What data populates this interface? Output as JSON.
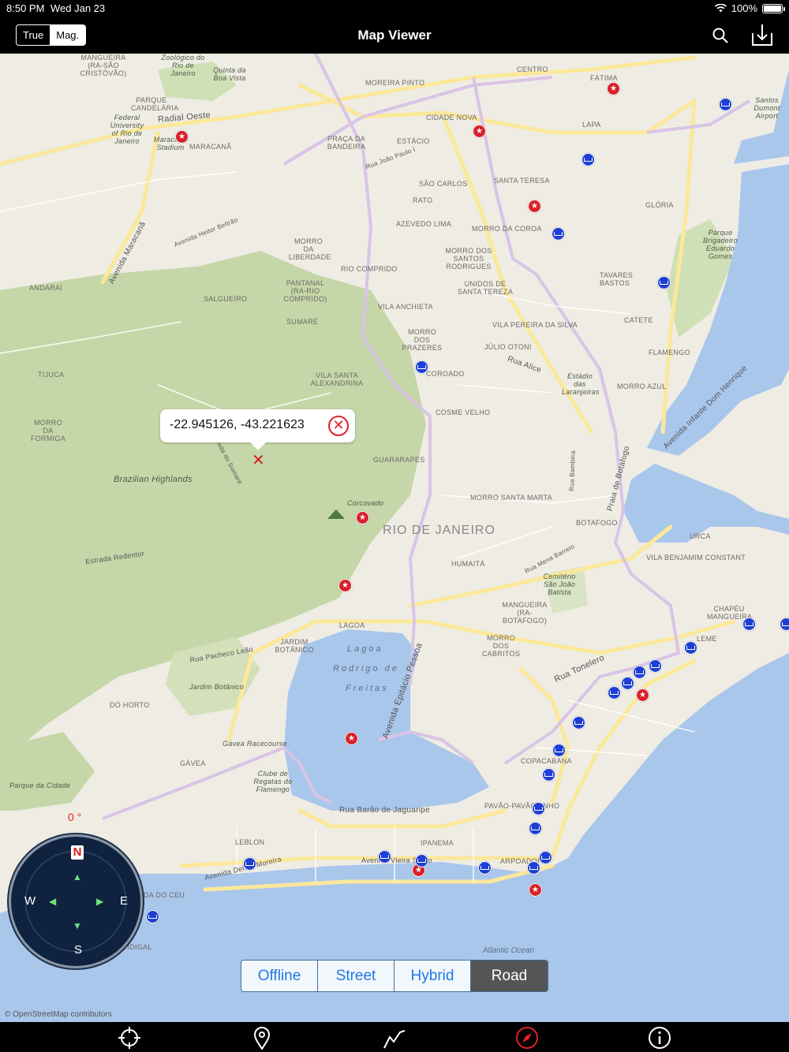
{
  "status": {
    "time": "8:50 PM",
    "date": "Wed Jan 23",
    "battery": "100%"
  },
  "nav": {
    "title": "Map Viewer",
    "north_toggle": {
      "options": [
        "True",
        "Mag."
      ],
      "selected": "Mag."
    },
    "icons": [
      "search-icon",
      "share-icon"
    ]
  },
  "map": {
    "callout": {
      "coords": "-22.945126, -43.221623"
    },
    "heading": "0 °",
    "compass": {
      "n": "N",
      "s": "S",
      "e": "E",
      "w": "W"
    },
    "labels": {
      "city": "RIO DE JANEIRO",
      "lagoa": "Lagoa",
      "rodrigo": "Rodrigo de",
      "freitas": "Freitas",
      "atlantic": "Atlantic Ocean",
      "brazilian_highlands": "Brazilian Highlands",
      "corcovado": "Corcovado",
      "jardim_botanico_it": "Jardim Botânico",
      "gavea_racecourse": "Gávea Racecourse",
      "parque_cidade": "Parque da Cidade",
      "clube": "Clube de Regatas do Flamengo",
      "parque_brigadeiro": "Parque Brigadeiro Eduardo Gomes",
      "cemiterio": "Cemitério São João Batista",
      "estadio": "Estádio das Laranjeiras",
      "quinta": "Quinta da Boa Vista",
      "zoologico": "Zoológico do Rio de Janeiro",
      "santos_dumont": "Santos Dumont Airport",
      "federal_uni": "Federal University of Rio de Janeiro",
      "maracana_stadium": "Maracanã Stadium",
      "mangueira": "MANGUEIRA (RA-SÃO CRISTÓVÃO)",
      "parque_candelaria": "PARQUE CANDELÁRIA",
      "maracana": "MARACANÃ",
      "moreira_pinto": "MOREIRA PINTO",
      "centro": "CENTRO",
      "fatima": "FÁTIMA",
      "cidade_nova": "CIDADE NOVA",
      "lapa": "LAPA",
      "praca_bandeira": "PRAÇA DA BANDEIRA",
      "estacio": "ESTÁCIO",
      "sao_carlos": "SÃO CARLOS",
      "santa_teresa": "SANTA TERESA",
      "rato": "RATO",
      "gloria": "GLÓRIA",
      "azevedo_lima": "AZEVEDO LIMA",
      "morro_coroa": "MORRO DA COROA",
      "morro_liberdade": "MORRO DA LIBERDADE",
      "morro_santos": "MORRO DOS SANTOS RODRIGUES",
      "tavares_bastos": "TAVARES BASTOS",
      "rio_comprido": "RIO COMPRIDO",
      "unidos": "UNIDOS DE SANTA TEREZA",
      "andarai": "ANDARAÍ",
      "pantanal": "PANTANAL (RA-RIO COMPRIDO)",
      "salgueiro": "SALGUEIRO",
      "vila_anchieta": "VILA ANCHIETA",
      "catete": "CATETE",
      "sumare": "SUMARÉ",
      "vila_pereira": "VILA PEREIRA DA SILVA",
      "morro_prazeres": "MORRO DOS PRAZERES",
      "julio_otoni": "JÚLIO OTONI",
      "flamengo": "FLAMENGO",
      "tijuca": "TIJUCA",
      "vila_santa": "VILA SANTA ALEXANDRINA",
      "coroado": "COROADO",
      "morro_azul": "MORRO AZUL",
      "morro_formiga": "MORRO DA FORMIGA",
      "cosme_velho": "COSME VELHO",
      "guararapes": "GUARARAPES",
      "morro_santa_marta": "MORRO SANTA MARTA",
      "botafogo": "BOTAFOGO",
      "urca": "URCA",
      "humaita": "HUMAITÁ",
      "vila_benjamim": "VILA BENJAMIM CONSTANT",
      "mangueira_bot": "MANGUEIRA (RA-BOTAFOGO)",
      "chapeu": "CHAPÉU MANGUEIRA",
      "lagoa_n": "LAGOA",
      "leme": "LEME",
      "jardim_botanico": "JARDIM BOTÂNICO",
      "morro_cabritos": "MORRO DOS CABRITOS",
      "do_horto": "DO HORTO",
      "gavea": "GÁVEA",
      "copacabana": "COPACABANA",
      "pavao": "PAVÃO-PAVÃOZINHO",
      "leblon": "LEBLON",
      "ipanema": "IPANEMA",
      "arpoador": "ARPOADOR",
      "da_do_ceu": "DA DO CEU",
      "vidigal": "VIDIGAL",
      "radial_oeste": "Radial Oeste",
      "av_maracana": "Avenida Maracanã",
      "av_heitor": "Avenida Heitor Beltrão",
      "rua_alice": "Rua Alice",
      "estrada_sumare": "Estrada do Sumaré",
      "estrada_redentor": "Estrada Redentor",
      "rua_pacheco": "Rua Pacheco Leão",
      "av_epitacio": "Avenida Epitácio Pessoa",
      "rua_tonelero": "Rua Tonelero",
      "praia_botafogo": "Praia de Botafogo",
      "av_infante": "Avenida Infante Dom Henrique",
      "rua_barao": "Rua Barão de Jaguaripe",
      "av_vieira": "Avenida Vieira Souto",
      "av_delfim": "Avenida Delfim Moreira",
      "rua_mena": "Rua Mena Barreto",
      "rua_bambina": "Rua Bambina",
      "rua_joao_paulo": "Rua João Paulo I"
    },
    "map_types": [
      "Offline",
      "Street",
      "Hybrid",
      "Road"
    ],
    "map_type_selected": "Road",
    "copyright": "© OpenStreetMap contributors"
  },
  "tabbar": {
    "icons": [
      "locate-icon",
      "pin-icon",
      "route-icon",
      "compass-icon",
      "info-icon"
    ],
    "active": "compass-icon",
    "active_color": "#e0202a"
  }
}
